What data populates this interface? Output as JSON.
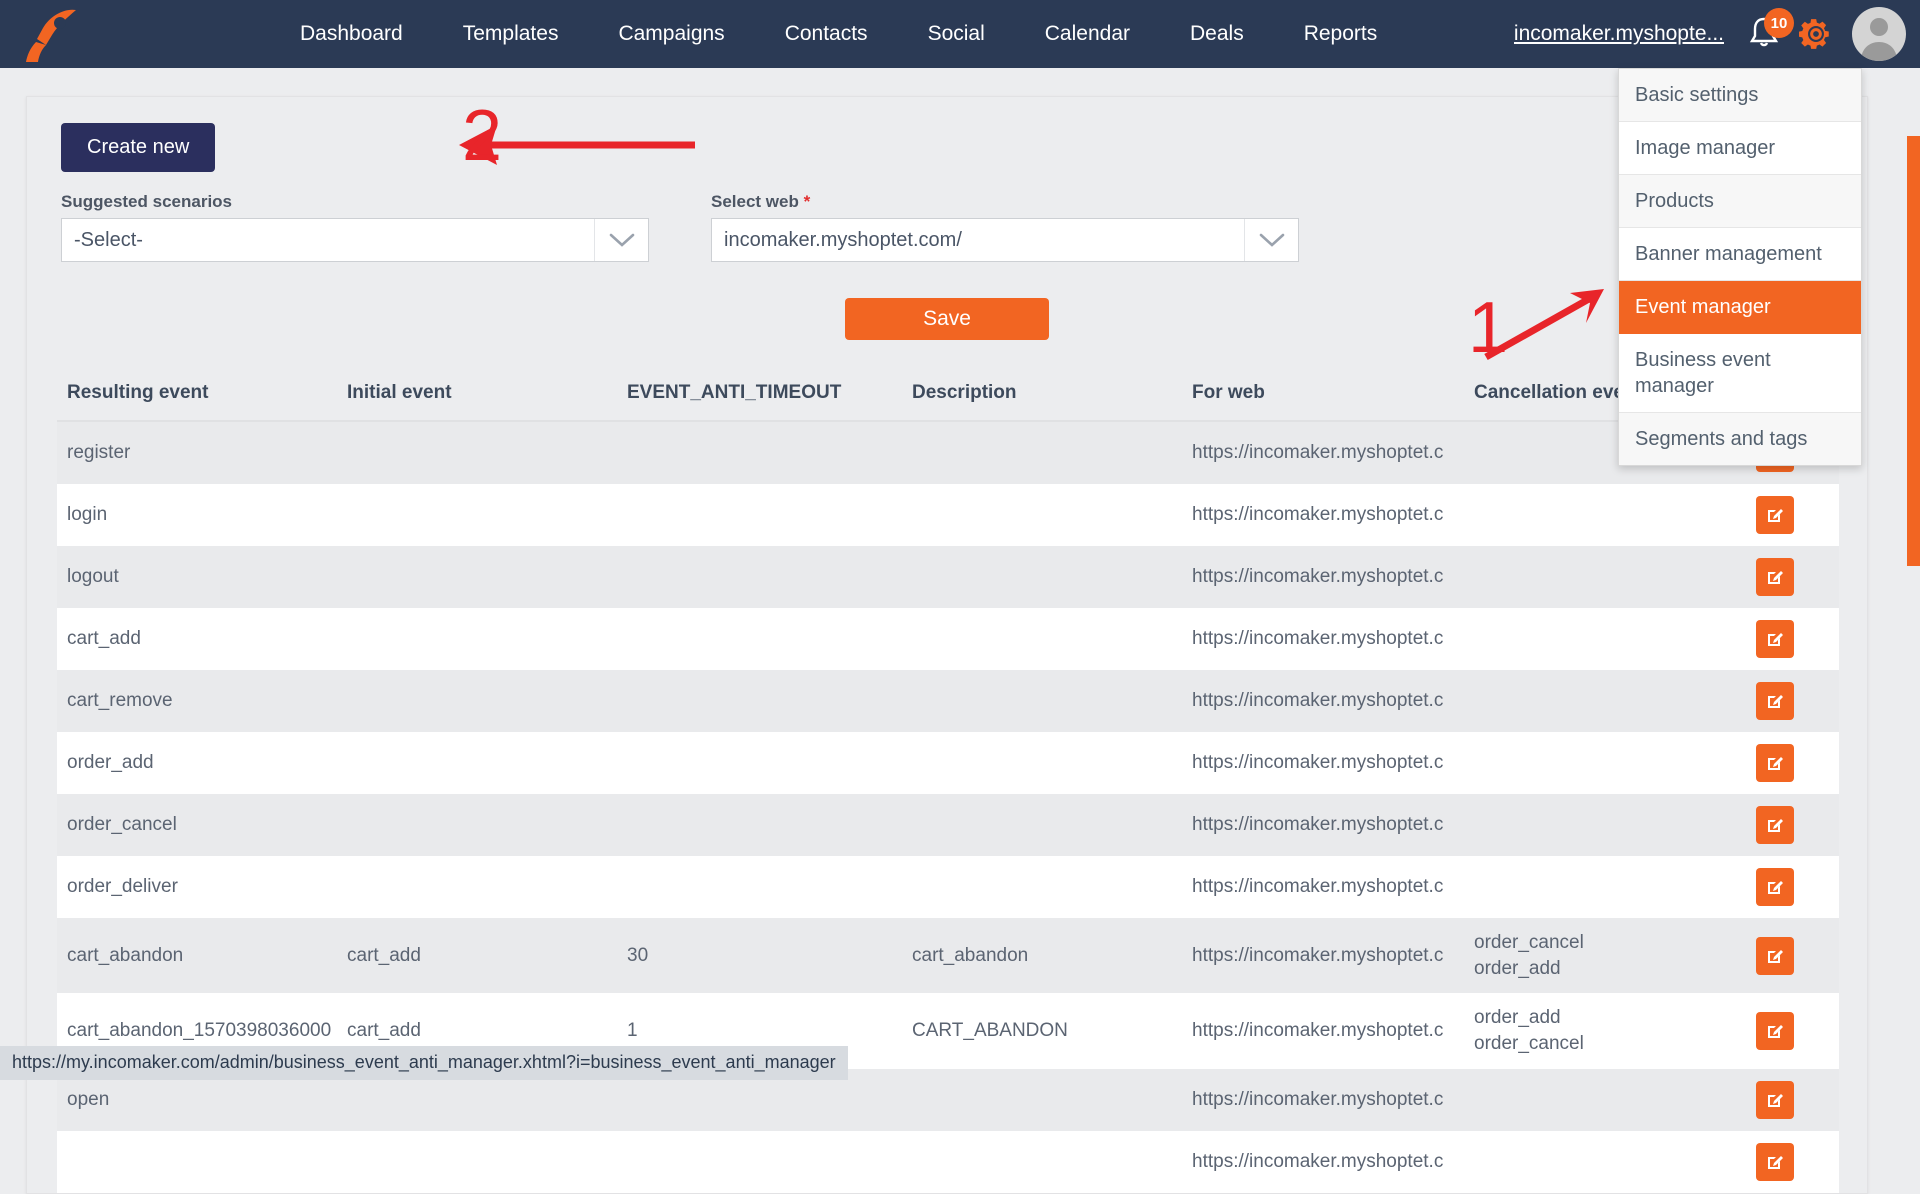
{
  "navbar": {
    "logo_icon": "rocket-logo-icon",
    "links": [
      {
        "label": "Dashboard"
      },
      {
        "label": "Templates"
      },
      {
        "label": "Campaigns"
      },
      {
        "label": "Contacts"
      },
      {
        "label": "Social"
      },
      {
        "label": "Calendar"
      },
      {
        "label": "Deals"
      },
      {
        "label": "Reports"
      }
    ],
    "account_label": "incomaker.myshopte...",
    "notification_icon": "bell-icon",
    "notification_count": "10",
    "settings_icon": "gear-icon",
    "avatar_icon": "user-avatar-icon"
  },
  "dropdown": {
    "items": [
      {
        "label": "Basic settings",
        "active": false
      },
      {
        "label": "Image manager",
        "active": false
      },
      {
        "label": "Products",
        "active": false
      },
      {
        "label": "Banner management",
        "active": false
      },
      {
        "label": "Event manager",
        "active": true
      },
      {
        "label": "Business event manager",
        "active": false
      },
      {
        "label": "Segments and tags",
        "active": false
      }
    ]
  },
  "form": {
    "create_button": "Create new",
    "scenario_label": "Suggested scenarios",
    "scenario_value": "-Select-",
    "web_label": "Select web",
    "web_required_mark": "*",
    "web_value": "incomaker.myshoptet.com/",
    "save_button": "Save",
    "dropdown_icon": "chevron-down-icon"
  },
  "table": {
    "headers": [
      "Resulting event",
      "Initial event",
      "EVENT_ANTI_TIMEOUT",
      "Description",
      "For web",
      "Cancellation event",
      ""
    ],
    "edit_icon": "edit-pencil-icon",
    "rows": [
      {
        "resulting": "register",
        "initial": "",
        "timeout": "",
        "description": "",
        "web": "https://incomaker.myshoptet.c",
        "cancellation": ""
      },
      {
        "resulting": "login",
        "initial": "",
        "timeout": "",
        "description": "",
        "web": "https://incomaker.myshoptet.c",
        "cancellation": ""
      },
      {
        "resulting": "logout",
        "initial": "",
        "timeout": "",
        "description": "",
        "web": "https://incomaker.myshoptet.c",
        "cancellation": ""
      },
      {
        "resulting": "cart_add",
        "initial": "",
        "timeout": "",
        "description": "",
        "web": "https://incomaker.myshoptet.c",
        "cancellation": ""
      },
      {
        "resulting": "cart_remove",
        "initial": "",
        "timeout": "",
        "description": "",
        "web": "https://incomaker.myshoptet.c",
        "cancellation": ""
      },
      {
        "resulting": "order_add",
        "initial": "",
        "timeout": "",
        "description": "",
        "web": "https://incomaker.myshoptet.c",
        "cancellation": ""
      },
      {
        "resulting": "order_cancel",
        "initial": "",
        "timeout": "",
        "description": "",
        "web": "https://incomaker.myshoptet.c",
        "cancellation": ""
      },
      {
        "resulting": "order_deliver",
        "initial": "",
        "timeout": "",
        "description": "",
        "web": "https://incomaker.myshoptet.c",
        "cancellation": ""
      },
      {
        "resulting": "cart_abandon",
        "initial": "cart_add",
        "timeout": "30",
        "description": "cart_abandon",
        "web": "https://incomaker.myshoptet.c",
        "cancellation": "order_cancel\norder_add"
      },
      {
        "resulting": "cart_abandon_1570398036000",
        "initial": "cart_add",
        "timeout": "1",
        "description": "CART_ABANDON",
        "web": "https://incomaker.myshoptet.c",
        "cancellation": "order_add\norder_cancel"
      },
      {
        "resulting": "open",
        "initial": "",
        "timeout": "",
        "description": "",
        "web": "https://incomaker.myshoptet.c",
        "cancellation": ""
      },
      {
        "resulting": "",
        "initial": "",
        "timeout": "",
        "description": "",
        "web": "https://incomaker.myshoptet.c",
        "cancellation": ""
      }
    ]
  },
  "annotations": [
    {
      "label": "1",
      "name": "annotation-number-1"
    },
    {
      "label": "2",
      "name": "annotation-number-2"
    }
  ],
  "statusbar": {
    "url": "https://my.incomaker.com/admin/business_event_anti_manager.xhtml?i=business_event_anti_manager"
  },
  "colors": {
    "navbar_bg": "#2b3a55",
    "accent_orange": "#f26522",
    "dark_blue_button": "#2b2f5e",
    "annotation_red": "#e8252a",
    "page_bg": "#ecedef"
  }
}
